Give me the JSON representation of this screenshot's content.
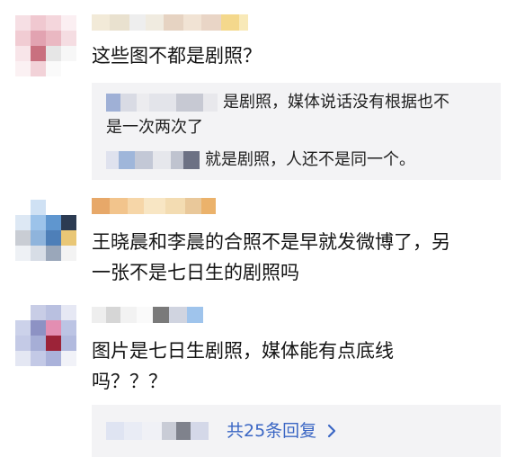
{
  "comments": [
    {
      "text_lines": [
        "这些图不都是剧照？"
      ]
    },
    {
      "text_lines": [
        "王晓晨和李晨的合照不是早就发微博了，另",
        "一张不是七日生的剧照吗"
      ]
    },
    {
      "text_lines": [
        "图片是七日生剧照，媒体能有点底线",
        "吗？？？"
      ]
    }
  ],
  "replies": [
    {
      "line1": "是剧照，媒体说话没有根据也不",
      "line2": "是一次两次了"
    },
    {
      "line1": "就是剧照，人还不是同一个。"
    }
  ],
  "more_replies": {
    "label": "共25条回复"
  },
  "colors": {
    "link": "#3a66c4",
    "quote_bg": "#f3f3f5"
  }
}
